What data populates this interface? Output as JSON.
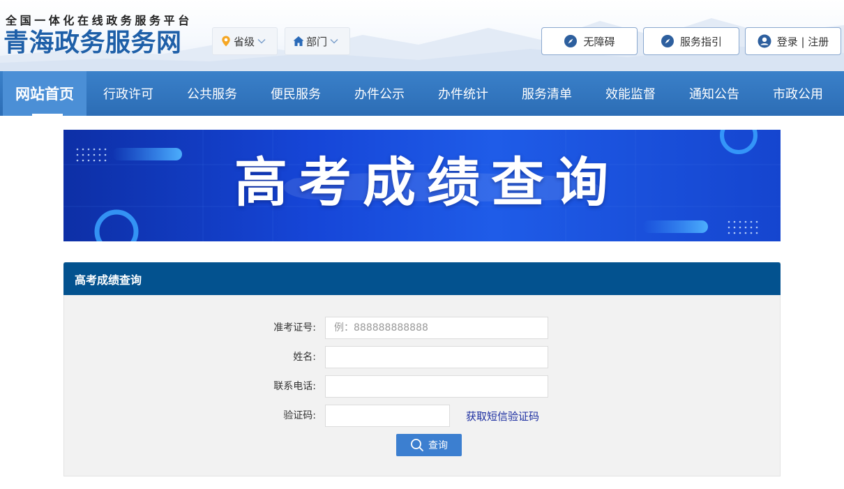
{
  "header": {
    "subtitle": "全国一体化在线政务服务平台",
    "site_name": "青海政务服务网",
    "province_label": "省级",
    "dept_label": "部门",
    "accessibility_label": "无障碍",
    "guide_label": "服务指引",
    "login_label": "登录 | 注册"
  },
  "nav": {
    "items": [
      {
        "label": "网站首页"
      },
      {
        "label": "行政许可"
      },
      {
        "label": "公共服务"
      },
      {
        "label": "便民服务"
      },
      {
        "label": "办件公示"
      },
      {
        "label": "办件统计"
      },
      {
        "label": "服务清单"
      },
      {
        "label": "效能监督"
      },
      {
        "label": "通知公告"
      },
      {
        "label": "市政公用"
      }
    ]
  },
  "banner": {
    "title": "高考成绩查询"
  },
  "form": {
    "title": "高考成绩查询",
    "exam_no_label": "准考证号:",
    "exam_no_placeholder": "例：888888888888",
    "exam_no_value": "",
    "name_label": "姓名:",
    "name_value": "",
    "phone_label": "联系电话:",
    "phone_value": "",
    "code_label": "验证码:",
    "code_value": "",
    "sms_label": "获取短信验证码",
    "query_label": "查询"
  },
  "colors": {
    "brand_blue": "#1e5fa8",
    "nav_blue": "#2c6db5",
    "panel_head": "#03528f",
    "button_blue": "#3c7fd0"
  }
}
